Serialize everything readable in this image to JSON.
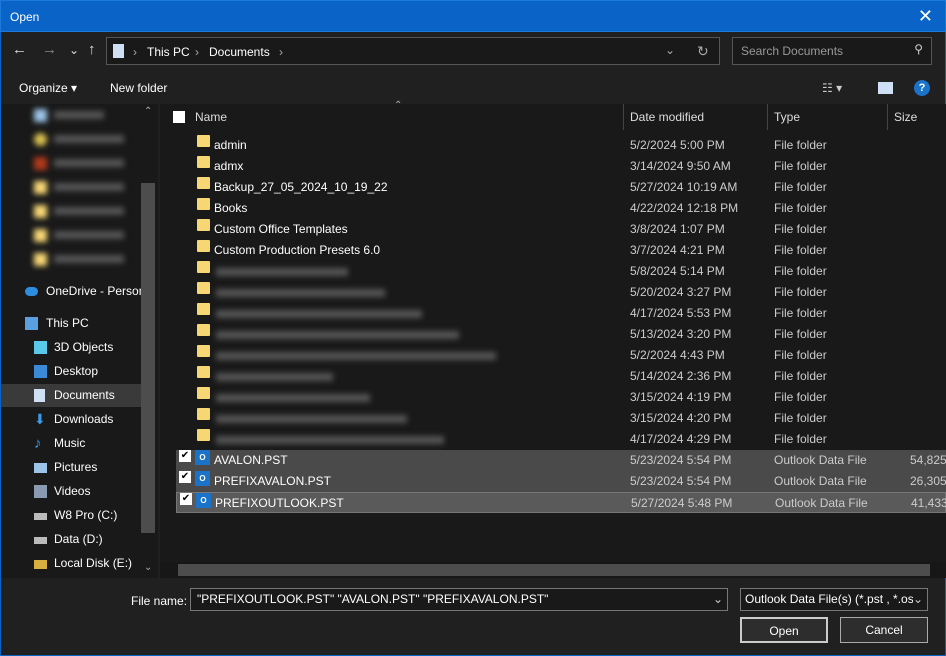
{
  "window": {
    "title": "Open",
    "close": "✕"
  },
  "nav": {
    "back": "←",
    "forward": "→",
    "recent": "⌄",
    "up": "↑",
    "refresh": "↻",
    "dropdown": "⌄"
  },
  "address": {
    "crumbs": [
      "This PC",
      "Documents"
    ],
    "sep": "›"
  },
  "search": {
    "placeholder": "Search Documents",
    "icon": "search-icon"
  },
  "toolbar": {
    "organize": "Organize ▾",
    "new_folder": "New folder",
    "help": "?"
  },
  "sidebar": {
    "items": [
      {
        "label": "OneDrive - Personal",
        "icon": "cloud-icon"
      },
      {
        "label": "This PC",
        "icon": "computer-icon"
      },
      {
        "label": "3D Objects",
        "icon": "cube-icon"
      },
      {
        "label": "Desktop",
        "icon": "desktop-icon"
      },
      {
        "label": "Documents",
        "icon": "document-icon",
        "selected": true
      },
      {
        "label": "Downloads",
        "icon": "download-icon"
      },
      {
        "label": "Music",
        "icon": "music-icon"
      },
      {
        "label": "Pictures",
        "icon": "pictures-icon"
      },
      {
        "label": "Videos",
        "icon": "videos-icon"
      },
      {
        "label": "W8 Pro (C:)",
        "icon": "drive-icon"
      },
      {
        "label": "Data (D:)",
        "icon": "drive-icon"
      },
      {
        "label": "Local Disk (E:)",
        "icon": "drive-icon"
      }
    ]
  },
  "columns": {
    "name": "Name",
    "date": "Date modified",
    "type": "Type",
    "size": "Size"
  },
  "files": [
    {
      "name": "admin",
      "date": "5/2/2024 5:00 PM",
      "type": "File folder",
      "size": ""
    },
    {
      "name": "admx",
      "date": "3/14/2024 9:50 AM",
      "type": "File folder",
      "size": ""
    },
    {
      "name": "Backup_27_05_2024_10_19_22",
      "date": "5/27/2024 10:19 AM",
      "type": "File folder",
      "size": ""
    },
    {
      "name": "Books",
      "date": "4/22/2024 12:18 PM",
      "type": "File folder",
      "size": ""
    },
    {
      "name": "Custom Office Templates",
      "date": "3/8/2024 1:07 PM",
      "type": "File folder",
      "size": ""
    },
    {
      "name": "Custom Production Presets 6.0",
      "date": "3/7/2024 4:21 PM",
      "type": "File folder",
      "size": ""
    },
    {
      "name": "",
      "date": "5/8/2024 5:14 PM",
      "type": "File folder",
      "size": "",
      "blurred": true
    },
    {
      "name": "",
      "date": "5/20/2024 3:27 PM",
      "type": "File folder",
      "size": "",
      "blurred": true
    },
    {
      "name": "",
      "date": "4/17/2024 5:53 PM",
      "type": "File folder",
      "size": "",
      "blurred": true
    },
    {
      "name": "",
      "date": "5/13/2024 3:20 PM",
      "type": "File folder",
      "size": "",
      "blurred": true
    },
    {
      "name": "",
      "date": "5/2/2024 4:43 PM",
      "type": "File folder",
      "size": "",
      "blurred": true
    },
    {
      "name": "",
      "date": "5/14/2024 2:36 PM",
      "type": "File folder",
      "size": "",
      "blurred": true
    },
    {
      "name": "",
      "date": "3/15/2024 4:19 PM",
      "type": "File folder",
      "size": "",
      "blurred": true
    },
    {
      "name": "",
      "date": "3/15/2024 4:20 PM",
      "type": "File folder",
      "size": "",
      "blurred": true
    },
    {
      "name": "",
      "date": "4/17/2024 4:29 PM",
      "type": "File folder",
      "size": "",
      "blurred": true
    },
    {
      "name": "AVALON.PST",
      "date": "5/23/2024 5:54 PM",
      "type": "Outlook Data File",
      "size": "54,825",
      "selected": true
    },
    {
      "name": "PREFIXAVALON.PST",
      "date": "5/23/2024 5:54 PM",
      "type": "Outlook Data File",
      "size": "26,305",
      "selected": true
    },
    {
      "name": "PREFIXOUTLOOK.PST",
      "date": "5/27/2024 5:48 PM",
      "type": "Outlook Data File",
      "size": "41,433",
      "selected": true
    }
  ],
  "footer": {
    "file_name_label": "File name:",
    "file_name_value": "\"PREFIXOUTLOOK.PST\" \"AVALON.PST\" \"PREFIXAVALON.PST\"",
    "file_type": "Outlook Data File(s) (*.pst , *.ost)",
    "open": "Open",
    "cancel": "Cancel"
  },
  "colors": {
    "accent": "#0a64c8",
    "folder": "#f7d774",
    "outlook": "#1a73c9"
  }
}
